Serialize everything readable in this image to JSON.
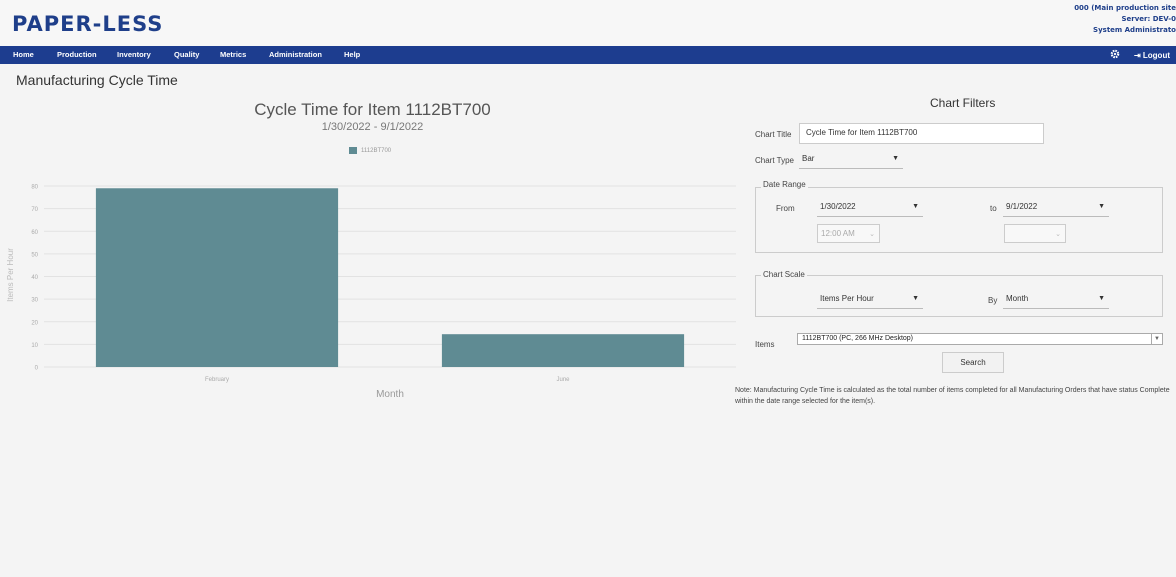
{
  "header": {
    "logo": "PAPER-LESS",
    "site": "000 (Main production site",
    "server": "Server: DEV-0",
    "user": "System Administrato"
  },
  "nav": {
    "items": [
      "Home",
      "Production",
      "Inventory",
      "Quality",
      "Metrics",
      "Administration",
      "Help"
    ],
    "settings_icon": "gear-icon",
    "logout_icon": "sign-out-icon",
    "logout_label": "Logout"
  },
  "page": {
    "title": "Manufacturing Cycle Time"
  },
  "chart_data": {
    "type": "bar",
    "title": "Cycle Time for Item 1112BT700",
    "subtitle": "1/30/2022 - 9/1/2022",
    "categories": [
      "February",
      "June"
    ],
    "series": [
      {
        "name": "1112BT700",
        "values": [
          79,
          14.5
        ]
      }
    ],
    "xlabel": "Month",
    "ylabel": "Items Per Hour",
    "ylim": [
      0,
      80
    ],
    "yticks": [
      0,
      10,
      20,
      30,
      40,
      50,
      60,
      70,
      80
    ],
    "grid": true,
    "legend": "top-center",
    "color": "#5f8b93"
  },
  "filters": {
    "title": "Chart Filters",
    "chart_title_label": "Chart Title",
    "chart_title_value": "Cycle Time for Item 1112BT700",
    "chart_type_label": "Chart Type",
    "chart_type_value": "Bar",
    "date_range_label": "Date Range",
    "from_label": "From",
    "from_date": "1/30/2022",
    "from_time": "12:00 AM",
    "to_label": "to",
    "to_date": "9/1/2022",
    "to_time": "",
    "chart_scale_label": "Chart Scale",
    "scale_value": "Items Per Hour",
    "by_label": "By",
    "by_value": "Month",
    "items_label": "Items",
    "items_value": "1112BT700 (PC, 266 MHz Desktop)",
    "search_label": "Search",
    "note": "Note: Manufacturing Cycle Time is calculated as the total number of items completed for all Manufacturing Orders that have status Complete within the date range selected for the item(s)."
  }
}
